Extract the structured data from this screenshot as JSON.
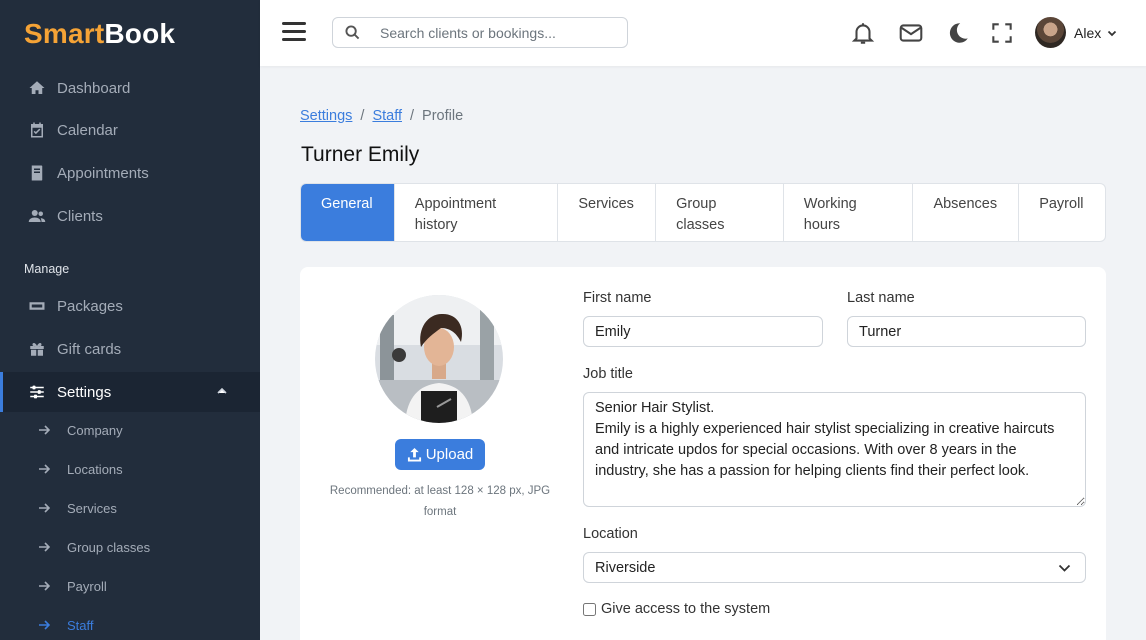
{
  "brand": {
    "part1": "Smart",
    "part2": "Book"
  },
  "sidebar": {
    "items": [
      {
        "label": "Dashboard",
        "icon": "home-icon"
      },
      {
        "label": "Calendar",
        "icon": "calendar-check-icon"
      },
      {
        "label": "Appointments",
        "icon": "book-icon"
      },
      {
        "label": "Clients",
        "icon": "users-icon"
      }
    ],
    "section_label": "Manage",
    "manage_items": [
      {
        "label": "Packages",
        "icon": "package-icon"
      },
      {
        "label": "Gift cards",
        "icon": "gift-icon"
      },
      {
        "label": "Settings",
        "icon": "sliders-icon"
      }
    ],
    "settings_sub": [
      "Company",
      "Locations",
      "Services",
      "Group classes",
      "Payroll",
      "Staff"
    ]
  },
  "header": {
    "search_placeholder": "Search clients or bookings...",
    "user_name": "Alex"
  },
  "breadcrumb": {
    "item1": "Settings",
    "item2": "Staff",
    "current": "Profile"
  },
  "page_title": "Turner Emily",
  "tabs": [
    {
      "line1": "General",
      "line2": ""
    },
    {
      "line1": "Appointment",
      "line2": "history"
    },
    {
      "line1": "Services",
      "line2": ""
    },
    {
      "line1": "Group",
      "line2": "classes"
    },
    {
      "line1": "Working",
      "line2": "hours"
    },
    {
      "line1": "Absences",
      "line2": ""
    },
    {
      "line1": "Payroll",
      "line2": ""
    }
  ],
  "profile": {
    "upload_label": "Upload",
    "recommend_text": "Recommended: at least 128 × 128 px, JPG format",
    "first_name_label": "First name",
    "first_name": "Emily",
    "last_name_label": "Last name",
    "last_name": "Turner",
    "job_title_label": "Job title",
    "job_title": "Senior Hair Stylist.\nEmily is a highly experienced hair stylist specializing in creative haircuts and intricate updos for special occasions. With over 8 years in the industry, she has a passion for helping clients find their perfect look.",
    "location_label": "Location",
    "location": "Riverside",
    "access_label": "Give access to the system"
  },
  "colors": {
    "accent": "#3b7ddd",
    "sidebar_bg": "#222d3c",
    "brand_orange": "#f5a336"
  }
}
